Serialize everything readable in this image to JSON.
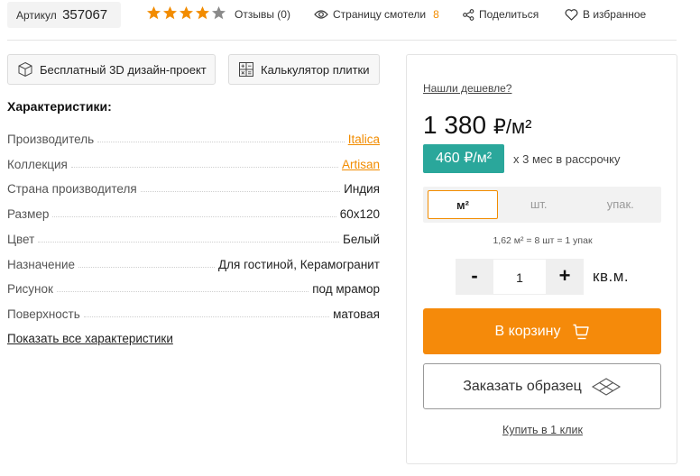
{
  "header": {
    "sku_label": "Артикул",
    "sku_value": "357067",
    "rating": 4,
    "rating_max": 5,
    "reviews_label": "Отзывы (0)",
    "views_label": "Страницу смотели",
    "views_count": "8",
    "share_label": "Поделиться",
    "favorite_label": "В избранное"
  },
  "tools": {
    "design_label": "Бесплатный 3D дизайн-проект",
    "calc_label": "Калькулятор плитки"
  },
  "characteristics": {
    "title": "Характеристики:",
    "rows": [
      {
        "key": "Производитель",
        "value": "Italica",
        "link": true
      },
      {
        "key": "Коллекция",
        "value": "Artisan",
        "link": true
      },
      {
        "key": "Страна производителя",
        "value": "Индия",
        "link": false
      },
      {
        "key": "Размер",
        "value": "60x120",
        "link": false
      },
      {
        "key": "Цвет",
        "value": "Белый",
        "link": false
      },
      {
        "key": "Назначение",
        "value": "Для гостиной, Керамогранит",
        "link": false
      },
      {
        "key": "Рисунок",
        "value": "под мрамор",
        "link": false
      },
      {
        "key": "Поверхность",
        "value": "матовая",
        "link": false
      }
    ],
    "show_all_label": "Показать все характеристики"
  },
  "buy": {
    "cheaper_label": "Нашли дешевле?",
    "price": "1 380",
    "price_unit": "₽/м²",
    "installment_price": "460 ₽/м²",
    "installment_text": "х 3 мес в рассрочку",
    "units": [
      "м²",
      "шт.",
      "упак."
    ],
    "active_unit": "м²",
    "conversion": "1,62 м² = 8 шт = 1 упак",
    "qty_minus": "-",
    "qty_value": "1",
    "qty_plus": "+",
    "qty_unit": "кв.м.",
    "cart_label": "В корзину",
    "sample_label": "Заказать образец",
    "one_click_label": "Купить в 1 клик"
  },
  "colors": {
    "accent": "#f58a0a",
    "star": "#f28c00",
    "star_empty": "#8a8a8a",
    "installment": "#2aa79b"
  }
}
